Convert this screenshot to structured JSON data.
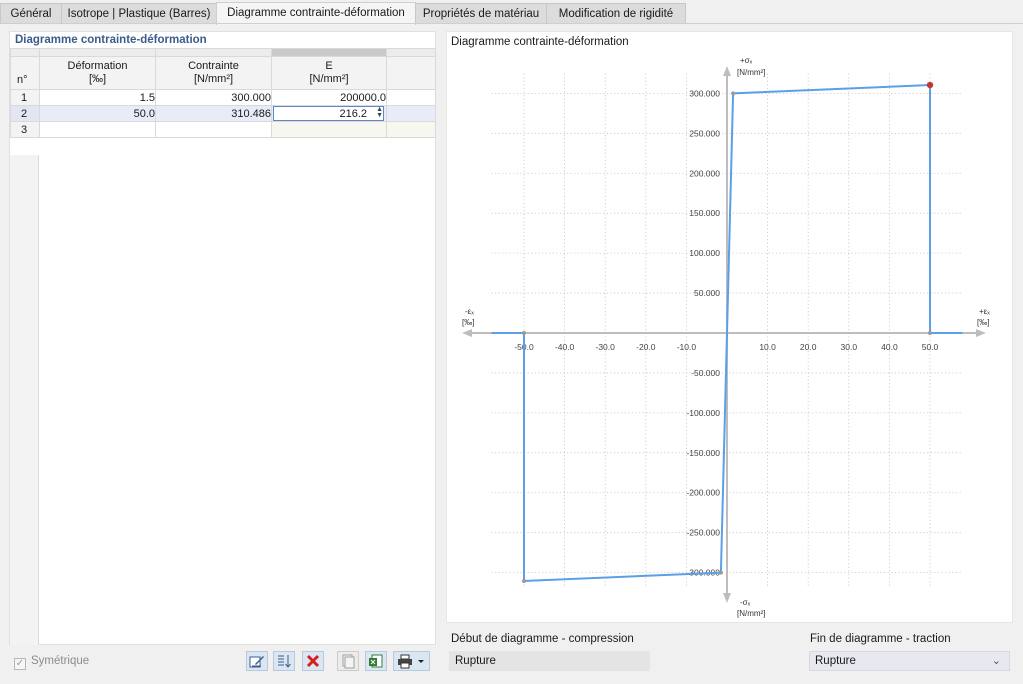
{
  "tabs": [
    {
      "label": "Général",
      "active": false
    },
    {
      "label": "Isotrope | Plastique (Barres)",
      "active": false
    },
    {
      "label": "Diagramme contrainte-déformation",
      "active": true
    },
    {
      "label": "Propriétés de matériau",
      "active": false
    },
    {
      "label": "Modification de rigidité",
      "active": false
    }
  ],
  "table": {
    "title": "Diagramme contrainte-déformation",
    "col_no": "n°",
    "columns": [
      {
        "label": "Déformation",
        "unit": "[‰]"
      },
      {
        "label": "Contrainte",
        "unit": "[N/mm²]"
      },
      {
        "label": "E",
        "unit": "[N/mm²]"
      }
    ],
    "rows": [
      {
        "n": "1",
        "deformation": "1.5",
        "contrainte": "300.000",
        "e": "200000.0"
      },
      {
        "n": "2",
        "deformation": "50.0",
        "contrainte": "310.486",
        "e": "216.2"
      },
      {
        "n": "3",
        "deformation": "",
        "contrainte": "",
        "e": ""
      }
    ]
  },
  "symetrique": {
    "label": "Symétrique",
    "checked": true
  },
  "toolbar_icons": [
    "edit-icon",
    "sort-icon",
    "delete-icon",
    "copy-icon",
    "excel-icon",
    "print-icon"
  ],
  "chart": {
    "title": "Diagramme contrainte-déformation",
    "y_pos_label": "+σₓ",
    "y_neg_label": "-σₓ",
    "y_unit": "[N/mm²]",
    "x_pos_label": "+εₓ",
    "x_neg_label": "-εₓ",
    "x_unit": "[‰]",
    "line_color": "#5aa0e6",
    "end_point_color": "#c0392b"
  },
  "chart_data": {
    "type": "line",
    "title": "Diagramme contrainte-déformation",
    "xlabel": "ε [‰]",
    "ylabel": "σ [N/mm²]",
    "xlim": [
      -60,
      60
    ],
    "ylim": [
      -330,
      330
    ],
    "x_ticks": [
      -50,
      -40,
      -30,
      -20,
      -10,
      10,
      20,
      30,
      40,
      50
    ],
    "x_tick_labels": [
      "-50.0",
      "-40.0",
      "-30.0",
      "-20.0",
      "-10.0",
      "10.0",
      "20.0",
      "30.0",
      "40.0",
      "50.0"
    ],
    "y_ticks": [
      300,
      250,
      200,
      150,
      100,
      50,
      -50,
      -100,
      -150,
      -200,
      -250,
      -300
    ],
    "y_tick_labels": [
      "300.000",
      "250.000",
      "200.000",
      "150.000",
      "100.000",
      "50.000",
      "-50.000",
      "-100.000",
      "-150.000",
      "-200.000",
      "-250.000",
      "-300.000"
    ],
    "grid": true,
    "series": [
      {
        "x": [
          -50,
          -50,
          -1.5,
          1.5,
          50,
          50
        ],
        "y": [
          0,
          -310.486,
          -300,
          300,
          310.486,
          0
        ]
      }
    ],
    "x_extend": [
      -58,
      58
    ]
  },
  "fields": {
    "debut_label": "Début de diagramme - compression",
    "debut_value": "Rupture",
    "fin_label": "Fin de diagramme - traction",
    "fin_value": "Rupture"
  }
}
